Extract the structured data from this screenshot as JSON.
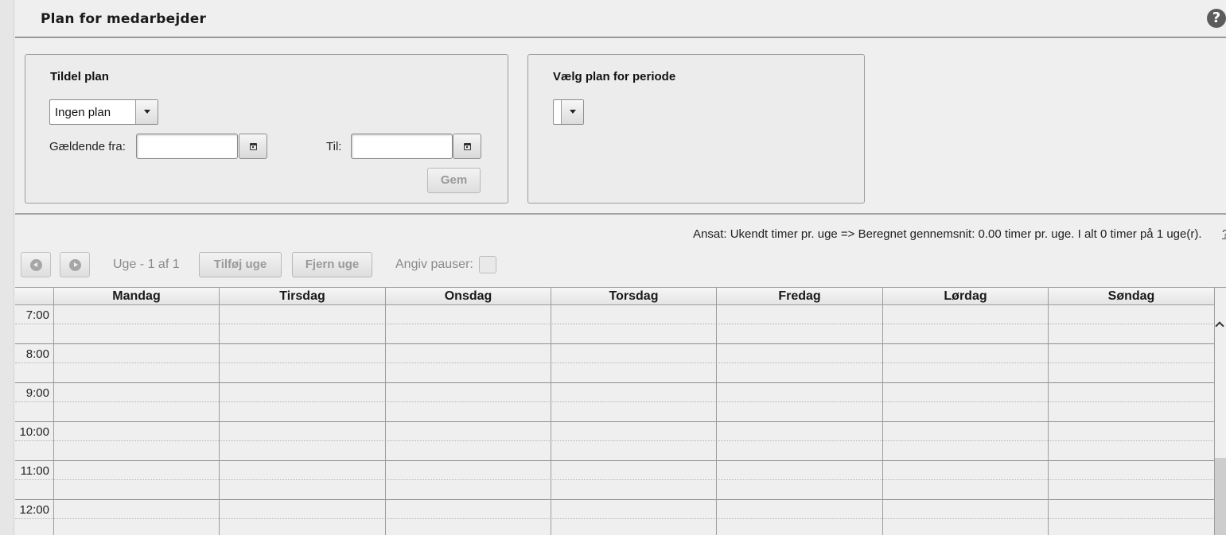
{
  "header": {
    "title": "Plan for medarbejder",
    "help_glyph": "?"
  },
  "assign_plan": {
    "title": "Tildel plan",
    "plan_select": {
      "value": "Ingen plan"
    },
    "valid_from_label": "Gældende fra:",
    "valid_from_value": "",
    "to_label": "Til:",
    "to_value": "",
    "save_label": "Gem"
  },
  "period_plan": {
    "title": "Vælg plan for periode",
    "select_value": ""
  },
  "summary": {
    "text": "Ansat: Ukendt timer pr. uge => Beregnet gennemsnit: 0.00 timer pr. uge. I alt 0 timer på 1 uge(r).",
    "tail": "?"
  },
  "toolbar": {
    "week_label": "Uge - 1 af 1",
    "add_week_label": "Tilføj uge",
    "remove_week_label": "Fjern uge",
    "pauses_label": "Angiv pauser:",
    "pauses_checked": false
  },
  "schedule": {
    "days": [
      "Mandag",
      "Tirsdag",
      "Onsdag",
      "Torsdag",
      "Fredag",
      "Lørdag",
      "Søndag"
    ],
    "hours": [
      "7:00",
      "8:00",
      "9:00",
      "10:00",
      "11:00",
      "12:00"
    ]
  }
}
